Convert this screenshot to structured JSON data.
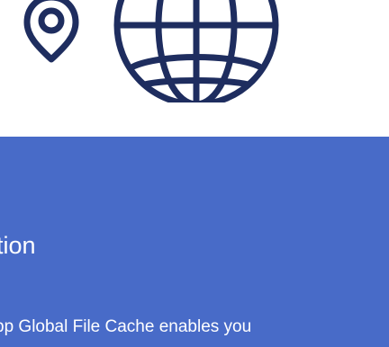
{
  "panel": {
    "title": "tion",
    "body": "pp Global File Cache enables you"
  },
  "icons": {
    "pin": "map-pin-icon",
    "globe": "globe-icon"
  },
  "colors": {
    "panel_background": "#486bc8",
    "icon_stroke": "#1e2d5f",
    "text": "#ffffff"
  }
}
